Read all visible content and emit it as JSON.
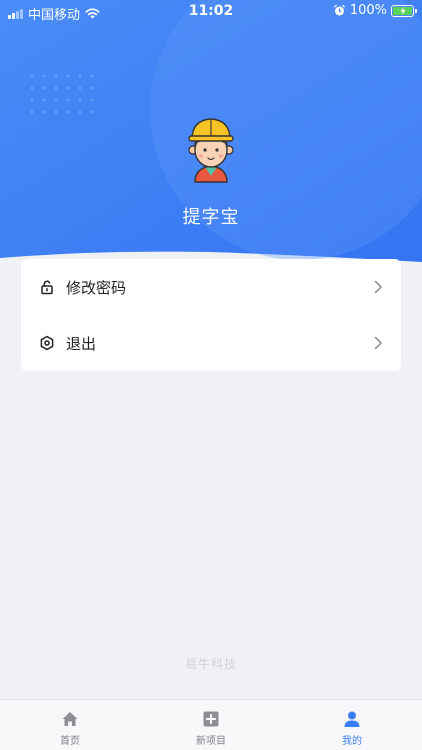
{
  "status_bar": {
    "carrier": "中国移动",
    "time": "11:02",
    "battery": "100%"
  },
  "profile": {
    "username": "提字宝"
  },
  "menu": {
    "items": [
      {
        "label": "修改密码",
        "icon": "lock-icon"
      },
      {
        "label": "退出",
        "icon": "logout-hexagon-icon"
      }
    ]
  },
  "footer": {
    "brand": "易牛科技"
  },
  "tabbar": {
    "tabs": [
      {
        "label": "首页",
        "icon": "home-icon",
        "active": false
      },
      {
        "label": "新项目",
        "icon": "plus-square-icon",
        "active": false
      },
      {
        "label": "我的",
        "icon": "user-icon",
        "active": true
      }
    ]
  },
  "colors": {
    "primary": "#3b7ff6",
    "background": "#f0f1f5"
  }
}
